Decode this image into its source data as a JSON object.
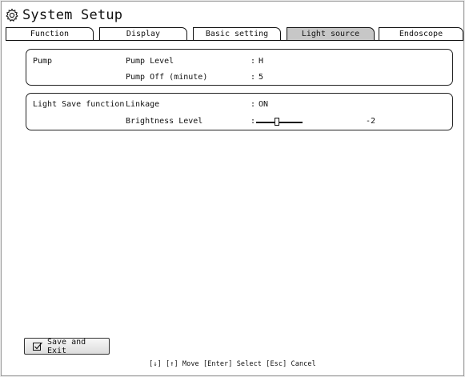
{
  "title": "System Setup",
  "icons": {
    "title": "gear-icon",
    "save": "checkbox-check-icon"
  },
  "tabs": [
    {
      "label": "Function",
      "active": false
    },
    {
      "label": "Display",
      "active": false
    },
    {
      "label": "Basic setting",
      "active": false
    },
    {
      "label": "Light source",
      "active": true
    },
    {
      "label": "Endoscope",
      "active": false
    }
  ],
  "pump": {
    "group_label": "Pump",
    "level_label": "Pump Level",
    "level_sep": ":",
    "level_value": "H",
    "off_label": "Pump Off (minute)",
    "off_sep": ":",
    "off_value": "5"
  },
  "light_save": {
    "group_label": "Light Save function",
    "linkage_label": "Linkage",
    "linkage_sep": ":",
    "linkage_value": "ON",
    "brightness_label": "Brightness Level",
    "brightness_sep": ":",
    "brightness_value": "-2",
    "brightness_fraction": 0.45
  },
  "save_button": {
    "label": "Save and Exit"
  },
  "hint": "[↓] [↑] Move  [Enter] Select  [Esc] Cancel",
  "colors": {
    "active_tab": "#c7c7c7",
    "border": "#111111",
    "background": "#ffffff"
  }
}
